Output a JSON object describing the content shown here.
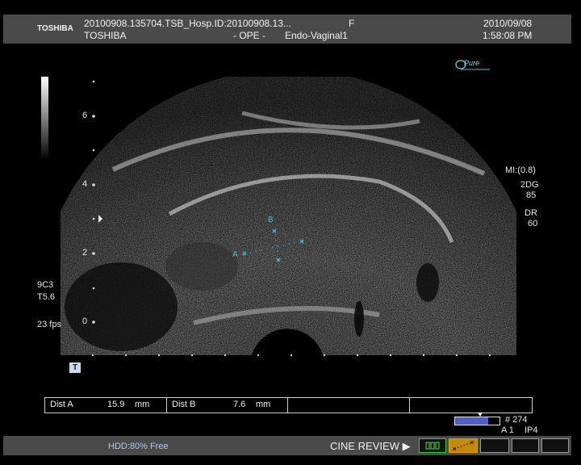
{
  "header": {
    "brand_logo": "TOSHIBA",
    "file_id": "20100908.135704.TSB_Hosp.ID:20100908.13...",
    "sex": "F",
    "date": "2010/09/08",
    "manufacturer": "TOSHIBA",
    "mode": "- OPE -",
    "preset": "Endo-Vaginal1",
    "time": "1:58:08 PM"
  },
  "pure_logo": "Pure",
  "depth_scale": {
    "labels": [
      "6",
      "4",
      "2",
      "0"
    ]
  },
  "left_panel": {
    "probe": "9C3",
    "tissue": "T5.6",
    "fps": "23 fps"
  },
  "right_panel": {
    "mi": "MI:(0.8)",
    "mode": "2DG",
    "gain": "85",
    "dr_label": "DR",
    "dr_value": "60"
  },
  "marker_t": "T",
  "calipers": {
    "a_label": "A",
    "b_label": "B"
  },
  "measurements": [
    {
      "name": "Dist A",
      "value": "15.9",
      "unit": "mm"
    },
    {
      "name": "Dist B",
      "value": "7.6",
      "unit": "mm"
    }
  ],
  "cine": {
    "frame": "# 274",
    "a_label": "A 1",
    "ip_label": "IP4",
    "position": 0.75
  },
  "footer": {
    "hdd": "HDD:80% Free",
    "cine_review": "CINE REVIEW ▶"
  },
  "colors": {
    "caliper": "#3fb8c8",
    "header_bg": "#4a4a4a",
    "hdd_text": "#a8c8ff",
    "active_button": "#e0a000",
    "green_button": "#3cc83c"
  }
}
